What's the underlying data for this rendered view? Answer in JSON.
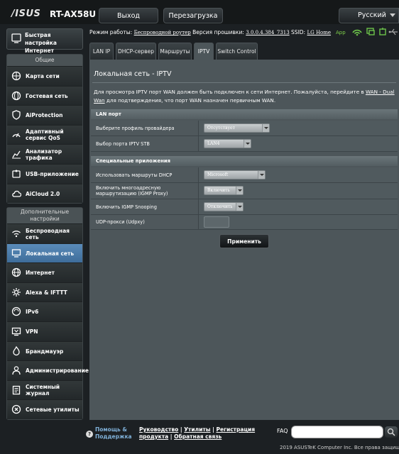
{
  "header": {
    "logo": "/ISUS",
    "model": "RT-AX58U",
    "logout_label": "Выход",
    "reboot_label": "Перезагрузка",
    "language": "Русский"
  },
  "status": {
    "mode_label": "Режим работы:",
    "mode_value": "Беспроводной роутер",
    "fw_label": "Версия прошивки:",
    "fw_value": "3.0.0.4.384_7313",
    "ssid_label": "SSID:",
    "ssid_value": "LG Home",
    "app_label": "App"
  },
  "sidebar": {
    "quick_setup": "Быстрая настройка Интернет",
    "general_title": "Общие",
    "general_items": [
      {
        "label": "Карта сети"
      },
      {
        "label": "Гостевая сеть"
      },
      {
        "label": "AiProtection"
      },
      {
        "label": "Адаптивный сервис QoS"
      },
      {
        "label": "Анализатор трафика"
      },
      {
        "label": "USB-приложение"
      },
      {
        "label": "AiCloud 2.0"
      }
    ],
    "advanced_title": "Дополнительные настройки",
    "advanced_items": [
      {
        "label": "Беспроводная сеть"
      },
      {
        "label": "Локальная сеть"
      },
      {
        "label": "Интернет"
      },
      {
        "label": "Alexa & IFTTT"
      },
      {
        "label": "IPv6"
      },
      {
        "label": "VPN"
      },
      {
        "label": "Брандмауэр"
      },
      {
        "label": "Администрирование"
      },
      {
        "label": "Системный журнал"
      },
      {
        "label": "Сетевые утилиты"
      }
    ]
  },
  "tabs": [
    {
      "label": "LAN IP"
    },
    {
      "label": "DHCP-сервер"
    },
    {
      "label": "Маршруты"
    },
    {
      "label": "IPTV"
    },
    {
      "label": "Switch Control"
    }
  ],
  "main": {
    "title": "Локальная сеть - IPTV",
    "desc_1": "Для просмотра IPTV порт WAN должен быть подключен к сети Интернет. Пожалуйста, перейдите в ",
    "desc_link": "WAN - Dual Wan",
    "desc_2": " для подтверждения, что порт WAN назначен первичным WAN.",
    "lan_section": "LAN порт",
    "provider_label": "Выберите профиль провайдера",
    "provider_value": "Отсутствует",
    "stb_label": "Выбор порта IPTV STB",
    "stb_value": "LAN4",
    "special_section": "Специальные приложения",
    "dhcp_routes_label": "Использовать маршруты DHCP",
    "dhcp_routes_value": "Microsoft",
    "igmp_proxy_label": "Включить многоадресную маршрутизацию (IGMP Proxy)",
    "igmp_proxy_value": "Включить",
    "igmp_snoop_label": "Включить IGMP Snooping",
    "igmp_snoop_value": "Отключить",
    "udpxy_label": "UDP-прокси (Udpxy)",
    "udpxy_value": "",
    "apply_label": "Применить"
  },
  "footer": {
    "help_line1": "Помощь &",
    "help_line2": "Поддержка",
    "links_line1_a": "Руководство",
    "links_line1_b": "Утилиты",
    "links_line1_c": "Регистрация",
    "links_line2_a": "продукта",
    "links_line2_b": "Обратная связь",
    "faq_label": "FAQ",
    "copyright": "2019 ASUSTeK Computer Inc. Все права защищены."
  }
}
